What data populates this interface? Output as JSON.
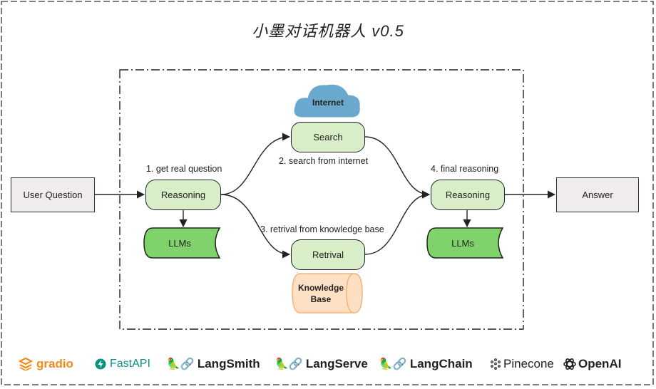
{
  "title": "小墨对话机器人 v0.5",
  "nodes": {
    "user_question": "User Question",
    "reasoning_left": "Reasoning",
    "llms_left": "LLMs",
    "internet": "Internet",
    "search": "Search",
    "retrival": "Retrival",
    "knowledge_base_line1": "Knowledge",
    "knowledge_base_line2": "Base",
    "reasoning_right": "Reasoning",
    "llms_right": "LLMs",
    "answer": "Answer"
  },
  "edge_labels": {
    "get_real_question": "1. get real question",
    "search_from_internet": "2. search from internet",
    "retrival_from_kb": "3. retrival from knowledge base",
    "final_reasoning": "4. final reasoning"
  },
  "logos": {
    "gradio": "gradio",
    "fastapi": "FastAPI",
    "langsmith": "LangSmith",
    "langserve": "LangServe",
    "langchain": "LangChain",
    "pinecone": "Pinecone",
    "openai": "OpenAI"
  },
  "colors": {
    "green_fill": "#d8eec8",
    "llm_fill": "#7fd36a",
    "cloud_fill": "#6aa9cd",
    "kb_fill": "#fde0c4",
    "kb_stroke": "#f4b27a",
    "gradio_orange": "#f48a1a",
    "fastapi_teal": "#0a9383"
  }
}
